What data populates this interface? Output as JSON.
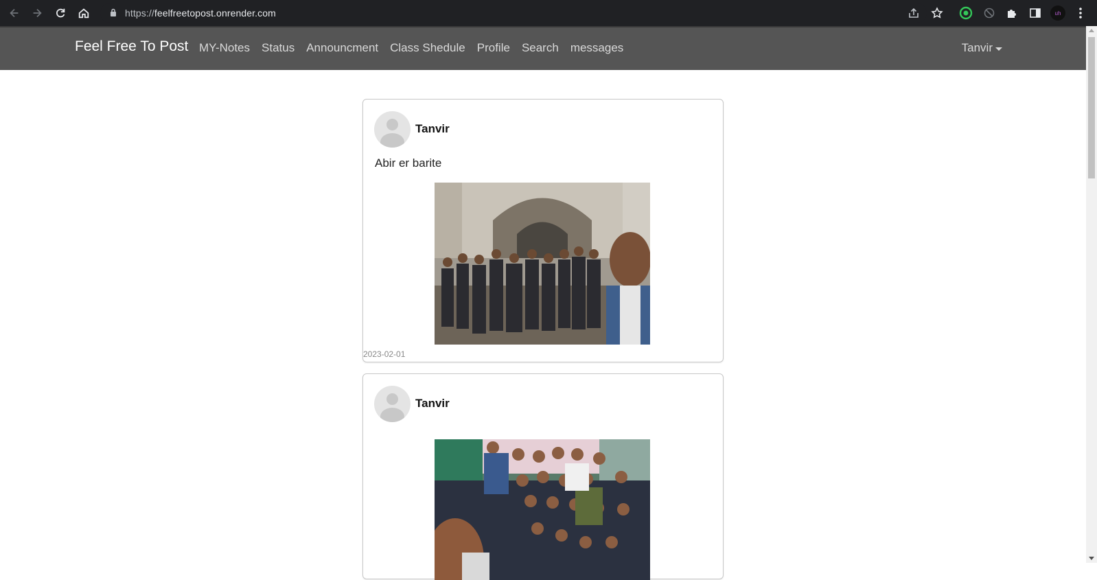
{
  "browser": {
    "url_scheme": "https://",
    "url_host": "feelfreetopost.onrender.com"
  },
  "navbar": {
    "brand": "Feel Free To Post",
    "links": [
      "MY-Notes",
      "Status",
      "Announcment",
      "Class Shedule",
      "Profile",
      "Search",
      "messages"
    ],
    "user": "Tanvir"
  },
  "posts": [
    {
      "author": "Tanvir",
      "text": "Abir er barite",
      "date": "2023-02-01"
    },
    {
      "author": "Tanvir",
      "text": "",
      "date": ""
    }
  ],
  "colors": {
    "chrome_bg": "#202124",
    "navbar_bg": "#555555",
    "brand_text": "#ffffff",
    "nav_text": "#d9d9d9"
  }
}
